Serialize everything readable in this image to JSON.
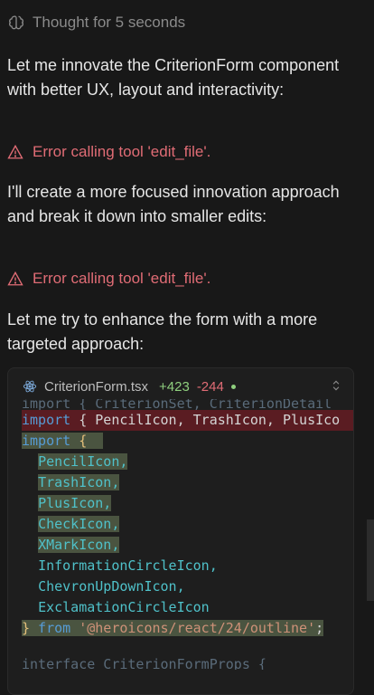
{
  "thought": {
    "label": "Thought for 5 seconds",
    "icon": "brain-icon"
  },
  "messages": [
    "Let me innovate the CriterionForm component with better UX, layout and interactivity:",
    "I'll create a more focused innovation approach and break it down into smaller edits:",
    "Let me try to enhance the form with a more targeted approach:"
  ],
  "errors": [
    "Error calling tool 'edit_file'.",
    "Error calling tool 'edit_file'."
  ],
  "code": {
    "file_icon": "react-icon",
    "filename": "CriterionForm.tsx",
    "additions": "+423",
    "deletions": "-244",
    "faded_top": "import { CriterionSet, CriterionDetail",
    "removed_line": {
      "kw": "import",
      "rest": " { PencilIcon, TrashIcon, PlusIco"
    },
    "added_open": {
      "kw": "import",
      "brace": " {"
    },
    "imports": [
      "PencilIcon,",
      "TrashIcon,",
      "PlusIcon,",
      "CheckIcon,",
      "XMarkIcon,",
      "InformationCircleIcon,",
      "ChevronUpDownIcon,",
      "ExclamationCircleIcon"
    ],
    "close_line": {
      "brace": "}",
      "from": " from ",
      "source": "'@heroicons/react/24/outline'",
      "semi": ";"
    },
    "faded_bottom": "interface CriterionFormProps {"
  },
  "colors": {
    "error": "#e06c75",
    "added": "#8fcf7e",
    "keyword": "#569cd6",
    "string": "#ce9178"
  }
}
